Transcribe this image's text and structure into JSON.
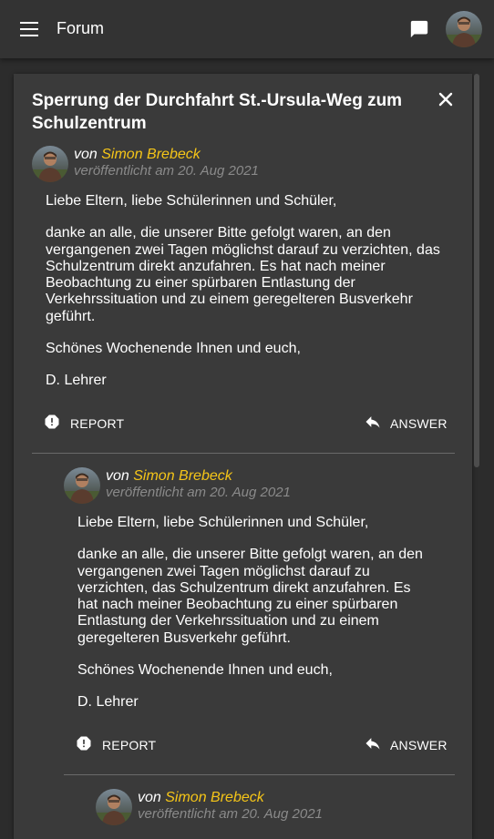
{
  "header": {
    "title": "Forum",
    "icons": [
      "menu-icon",
      "chat-icon",
      "avatar"
    ]
  },
  "thread": {
    "title": "Sperrung der Durchfahrt St.-Ursula-Weg zum Schulzentrum",
    "close_icon": "close-icon"
  },
  "posts": [
    {
      "by_prefix": "von",
      "author": "Simon Brebeck",
      "date": "veröffentlicht am 20. Aug 2021",
      "paragraphs": [
        "Liebe Eltern, liebe Schülerinnen und Schüler,",
        "danke an alle, die unserer Bitte gefolgt waren, an den vergangenen zwei Tagen möglichst darauf zu verzichten, das Schulzentrum direkt anzufahren. Es hat nach meiner Beobachtung zu einer spürbaren Entlastung der Verkehrssituation und zu einem geregelteren Busverkehr geführt.",
        "Schönes Wochenende Ihnen und euch,",
        "D. Lehrer"
      ],
      "report_label": "REPORT",
      "answer_label": "ANSWER"
    },
    {
      "by_prefix": "von",
      "author": "Simon Brebeck",
      "date": "veröffentlicht am 20. Aug 2021",
      "paragraphs": [
        "Liebe Eltern, liebe Schülerinnen und Schüler,",
        "danke an alle, die unserer Bitte gefolgt waren, an den vergangenen zwei Tagen möglichst darauf zu verzichten, das Schulzentrum direkt anzufahren. Es hat nach meiner Beobachtung zu einer spürbaren Entlastung der Verkehrssituation und zu einem geregelteren Busverkehr geführt.",
        "Schönes Wochenende Ihnen und euch,",
        "D. Lehrer"
      ],
      "report_label": "REPORT",
      "answer_label": "ANSWER"
    },
    {
      "by_prefix": "von",
      "author": "Simon Brebeck",
      "date": "veröffentlicht am 20. Aug 2021"
    }
  ],
  "colors": {
    "author": "#f5c518",
    "date": "#8a8a8a",
    "card": "#3a3a3a",
    "bar": "#333333"
  }
}
